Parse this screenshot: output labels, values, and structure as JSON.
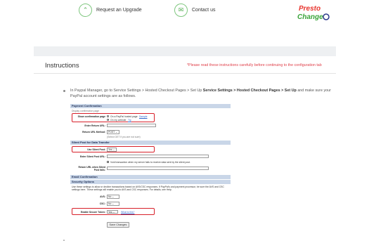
{
  "topbar": {
    "upgrade_icon": "chevron-up-circle-icon",
    "upgrade_label": "Request an Upgrade",
    "contact_icon": "mail-icon",
    "contact_label": "Contact us",
    "logo_line1": "Presto",
    "logo_line2": "Change",
    "brand_color": "#e8352e"
  },
  "instructions": {
    "title": "Instructions",
    "note": "*Please read these instructions carefully before continuing to the configuration tab",
    "step": {
      "prefix": "In Paypal Manager, go to Service Settings > Hosted Checkout Pages > Set Up",
      "bold": "Service Settings > Hosted Checkout Pages > Set Up",
      "suffix": "and make sure your PayPal account settings are as follows."
    }
  },
  "paypal": {
    "payment_confirmation": {
      "header": "Payment Confirmation",
      "hint": "Display confirmation page",
      "show_label": "Show confirmation page",
      "option1": "On a PayPal hosted page",
      "option1_link": "Sample",
      "option2": "On my website",
      "option2_link": "Tip",
      "return_url_label": "Enter Return URL:",
      "return_method_label": "Return URL Method:",
      "return_method_value": "POST",
      "return_method_hint": "(Select GET if you are not sure)"
    },
    "silent_post": {
      "header": "Silent Post for Data Transfer",
      "use_label": "Use Silent Post:",
      "use_value": "Yes",
      "url_label": "Enter Silent Post URL:",
      "void_text": "Void transaction when my server fails to receive data sent by the silent post.",
      "return_label": "Return URL when Silent Post fails:"
    },
    "email": {
      "header": "Email Confirmation"
    },
    "security": {
      "header": "Security Options",
      "desc": "Use these settings to allow or decline transactions based on AVS/CSC responses. If PayPal's and payment processor, be sure the AVS and CSC settings here. These settings will enable you to AVS and CSC responses. For details, see Help.",
      "avs_label": "AVS:",
      "avs_value": "No",
      "csc_label": "CSC:",
      "csc_value": "No",
      "token_label": "Enable Secure Token:",
      "token_value": "Yes",
      "token_link": "What is this?",
      "save_button": "Save Changes"
    }
  }
}
